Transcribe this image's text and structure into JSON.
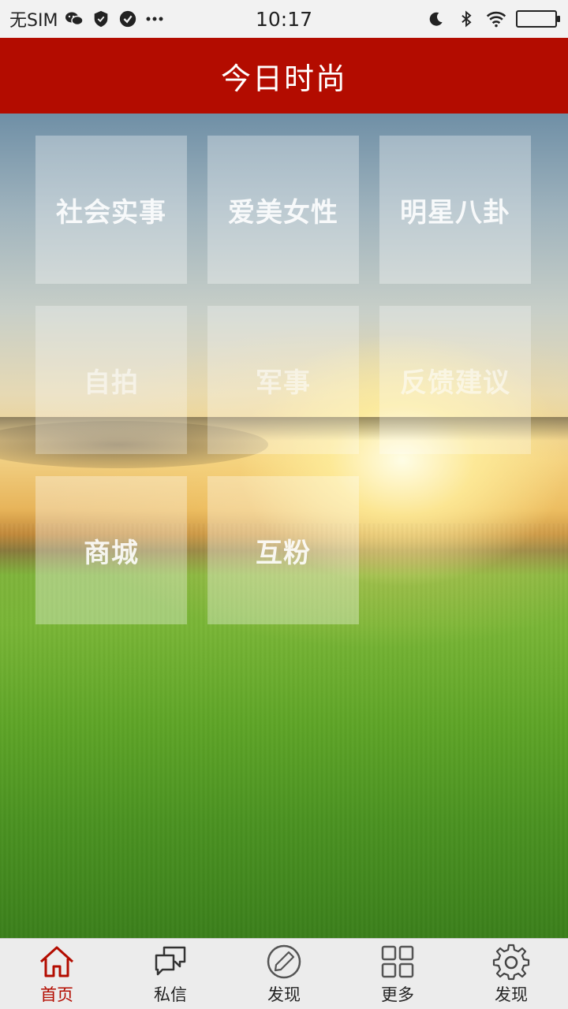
{
  "status_bar": {
    "carrier": "无SIM",
    "time": "10:17",
    "left_icons": [
      "wechat-icon",
      "shield-icon",
      "check-circle-icon",
      "more-dots-icon"
    ],
    "right_icons": [
      "moon-icon",
      "bluetooth-icon",
      "wifi-icon",
      "battery-icon"
    ]
  },
  "header": {
    "title": "今日时尚"
  },
  "grid": {
    "tiles": [
      {
        "label": "社会实事"
      },
      {
        "label": "爱美女性"
      },
      {
        "label": "明星八卦"
      },
      {
        "label": "自拍"
      },
      {
        "label": "军事"
      },
      {
        "label": "反馈建议"
      },
      {
        "label": "商城"
      },
      {
        "label": "互粉"
      }
    ]
  },
  "tabbar": {
    "items": [
      {
        "label": "首页",
        "icon": "home-icon",
        "active": true
      },
      {
        "label": "私信",
        "icon": "chat-bubbles-icon",
        "active": false
      },
      {
        "label": "发现",
        "icon": "compass-pen-icon",
        "active": false
      },
      {
        "label": "更多",
        "icon": "grid-icon",
        "active": false
      },
      {
        "label": "发现",
        "icon": "gear-icon",
        "active": false
      }
    ]
  },
  "colors": {
    "header_bg": "#b30c00",
    "active_tab": "#b30c00",
    "tabbar_bg": "#ececec"
  }
}
